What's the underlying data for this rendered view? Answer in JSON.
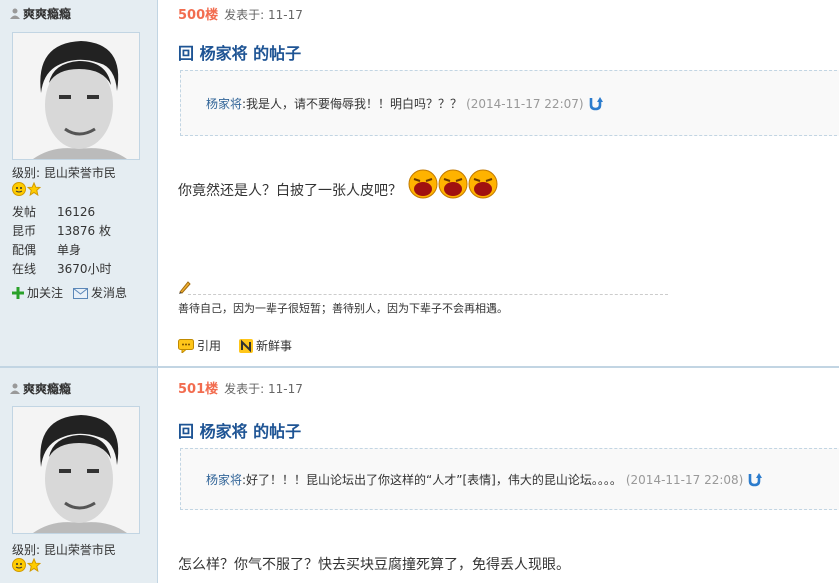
{
  "posts": [
    {
      "username": "爽爽瘾瘾",
      "level_label": "级别:",
      "level_value": "昆山荣誉市民",
      "stats": [
        {
          "k": "发帖",
          "v": "16126"
        },
        {
          "k": "昆币",
          "v": "13876 枚"
        },
        {
          "k": "配偶",
          "v": "单身"
        },
        {
          "k": "在线",
          "v": "3670小时"
        }
      ],
      "follow_label": "加关注",
      "message_label": "发消息",
      "floor": "500楼",
      "post_time": "发表于: 11-17",
      "title": "回 杨家将 的帖子",
      "quote_user": "杨家将",
      "quote_text": ":我是人，请不要侮辱我！！明白吗？？？",
      "quote_time": "(2014-11-17 22:07)",
      "body": "你竟然还是人？白披了一张人皮吧？",
      "signature": "善待自己，因为一辈子很短暂；善待别人，因为下辈子不会再相遇。",
      "reply_label": "引用",
      "news_label": "新鲜事"
    },
    {
      "username": "爽爽瘾瘾",
      "level_label": "级别:",
      "level_value": "昆山荣誉市民",
      "floor": "501楼",
      "post_time": "发表于: 11-17",
      "title": "回 杨家将 的帖子",
      "quote_user": "杨家将",
      "quote_text": ":好了！！！昆山论坛出了你这样的“人才”[表情]，伟大的昆山论坛。。。。",
      "quote_time": "(2014-11-17 22:08)",
      "body": "怎么样？你气不服了？快去买块豆腐撞死算了，免得丢人现眼。"
    }
  ],
  "colors": {
    "sidebar": "#e5edf2",
    "accent": "#1e5494",
    "floor": "#f26c4f"
  }
}
